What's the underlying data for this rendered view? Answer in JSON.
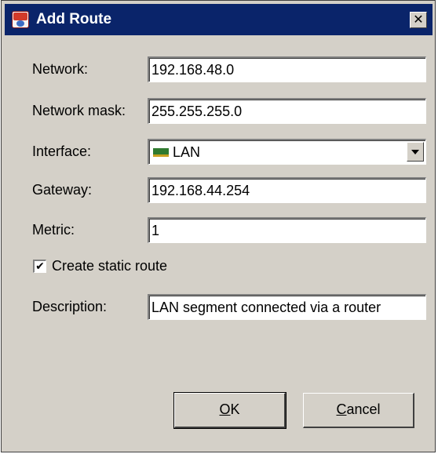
{
  "window": {
    "title": "Add Route",
    "close_glyph": "✕",
    "icon": "app-router-icon"
  },
  "form": {
    "network": {
      "label": "Network:",
      "value": "192.168.48.0"
    },
    "network_mask": {
      "label": "Network mask:",
      "value": "255.255.255.0"
    },
    "interface": {
      "label": "Interface:",
      "value": "LAN",
      "icon": "network-card-icon"
    },
    "gateway": {
      "label": "Gateway:",
      "value": "192.168.44.254"
    },
    "metric": {
      "label": "Metric:",
      "value": "1"
    },
    "static_route": {
      "label": "Create static route",
      "checked": true,
      "check_glyph": "✔"
    },
    "description": {
      "label": "Description:",
      "value": "LAN segment connected via a router"
    }
  },
  "buttons": {
    "ok": {
      "mnemonic": "O",
      "rest": "K"
    },
    "cancel": {
      "mnemonic": "C",
      "rest": "ancel"
    }
  },
  "colors": {
    "titlebar": "#0a246a",
    "dialog_bg": "#d4d0c8"
  }
}
